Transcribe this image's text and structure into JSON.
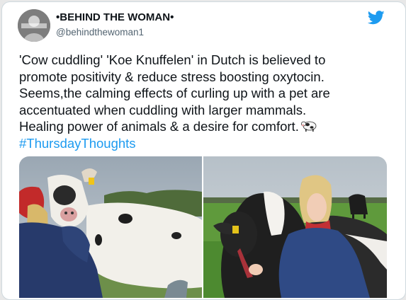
{
  "tweet": {
    "author_name": "•BEHIND THE WOMAN•",
    "author_handle": "@behindthewoman1",
    "text_lines": [
      "'Cow cuddling' 'Koe Knuffelen' in Dutch is believed to",
      "promote positivity & reduce stress boosting oxytocin.",
      "Seems,the calming effects of curling up with a pet are",
      "accentuated when cuddling with larger mammals.",
      "Healing power of animals & a desire for comfort."
    ],
    "hashtag": "#ThursdayThoughts",
    "emoji_icon": "cow-emoji-icon",
    "brand_icon": "twitter-bird-icon"
  },
  "colors": {
    "text": "#0f1419",
    "secondary_text": "#536471",
    "link": "#1d9bf0",
    "twitter_blue": "#1d9bf0"
  }
}
